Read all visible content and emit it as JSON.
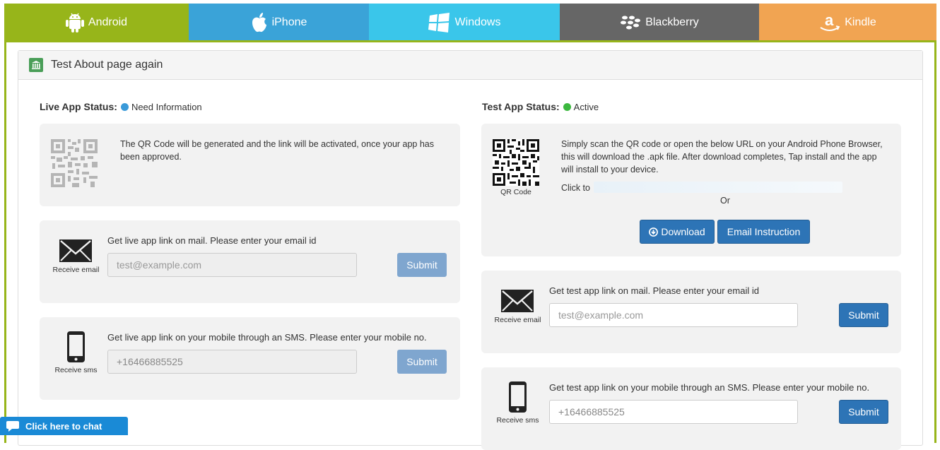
{
  "tabs": [
    {
      "label": "Android",
      "icon": "android-icon"
    },
    {
      "label": "iPhone",
      "icon": "apple-icon"
    },
    {
      "label": "Windows",
      "icon": "windows-icon"
    },
    {
      "label": "Blackberry",
      "icon": "blackberry-icon"
    },
    {
      "label": "Kindle",
      "icon": "amazon-icon"
    }
  ],
  "panel": {
    "title": "Test About page again",
    "icon": "bank-icon"
  },
  "live": {
    "status_label": "Live App Status:",
    "status_value": "Need Information",
    "status_color": "#3a9ad9",
    "qr_text": "The QR Code will be generated and the link will be activated, once your app has been approved.",
    "email": {
      "label": "Receive email",
      "prompt": "Get live app link on mail. Please enter your email id",
      "placeholder": "test@example.com",
      "submit": "Submit"
    },
    "sms": {
      "label": "Receive sms",
      "prompt": "Get live app link on your mobile through an SMS. Please enter your mobile no.",
      "value": "+16466885525",
      "submit": "Submit"
    }
  },
  "test": {
    "status_label": "Test App Status:",
    "status_value": "Active",
    "status_color": "#3cb83f",
    "qr_caption": "QR Code",
    "qr_text": "Simply scan the QR code or open the below URL on your Android Phone Browser, this will download the .apk file. After download completes, Tap install and the app will install to your device.",
    "click_prefix": "Click to",
    "or_text": "Or",
    "download_button": "Download",
    "email_instruction_button": "Email Instruction",
    "email": {
      "label": "Receive email",
      "prompt": "Get test app link on mail. Please enter your email id",
      "placeholder": "test@example.com",
      "submit": "Submit"
    },
    "sms": {
      "label": "Receive sms",
      "prompt": "Get test app link on your mobile through an SMS. Please enter your mobile no.",
      "value": "+16466885525",
      "submit": "Submit"
    }
  },
  "chat": {
    "label": "Click here to chat"
  }
}
